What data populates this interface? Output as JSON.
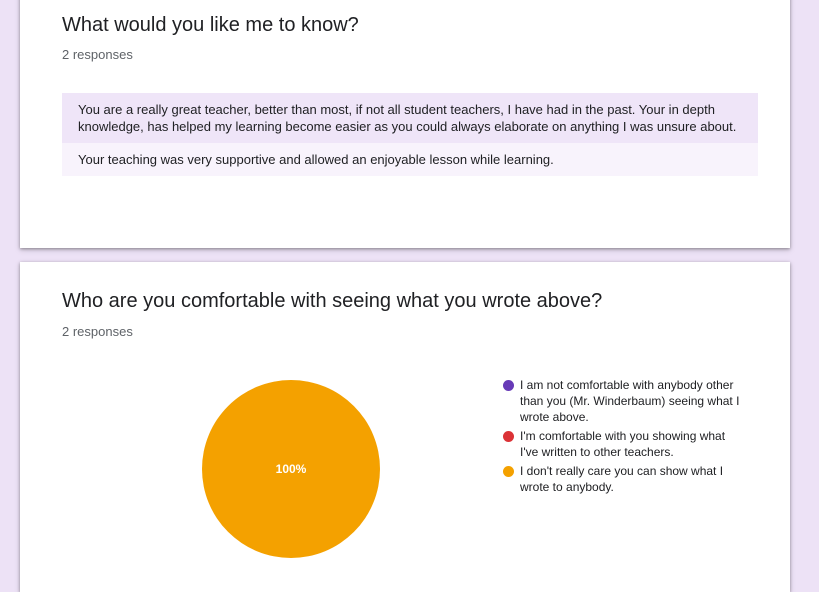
{
  "card1": {
    "title": "What would you like me to know?",
    "response_count": "2 responses",
    "responses": [
      "You are a really great teacher, better than most, if not all student teachers, I have had in the past. Your in depth knowledge, has helped my learning become easier as you could always elaborate on anything I was unsure about.",
      "Your teaching was very supportive and allowed an enjoyable lesson while learning."
    ]
  },
  "card2": {
    "title": "Who are you comfortable with seeing what you wrote above?",
    "response_count": "2 responses",
    "legend": [
      {
        "label": "I am not comfortable with anybody other than you (Mr. Winderbaum) seeing what I wrote above.",
        "color": "#673ab7"
      },
      {
        "label": "I'm comfortable with you showing what I've written to other teachers.",
        "color": "#db3236"
      },
      {
        "label": "I don't really care you can show what I wrote to anybody.",
        "color": "#f4a100"
      }
    ]
  },
  "chart_data": {
    "type": "pie",
    "categories": [
      "I am not comfortable with anybody other than you (Mr. Winderbaum) seeing what I wrote above.",
      "I'm comfortable with you showing what I've written to other teachers.",
      "I don't really care you can show what I wrote to anybody."
    ],
    "values": [
      0,
      0,
      2
    ],
    "colors": [
      "#673ab7",
      "#db3236",
      "#f4a100"
    ],
    "slice_labels": [
      "",
      "",
      "100%"
    ],
    "legend_position": "right"
  }
}
